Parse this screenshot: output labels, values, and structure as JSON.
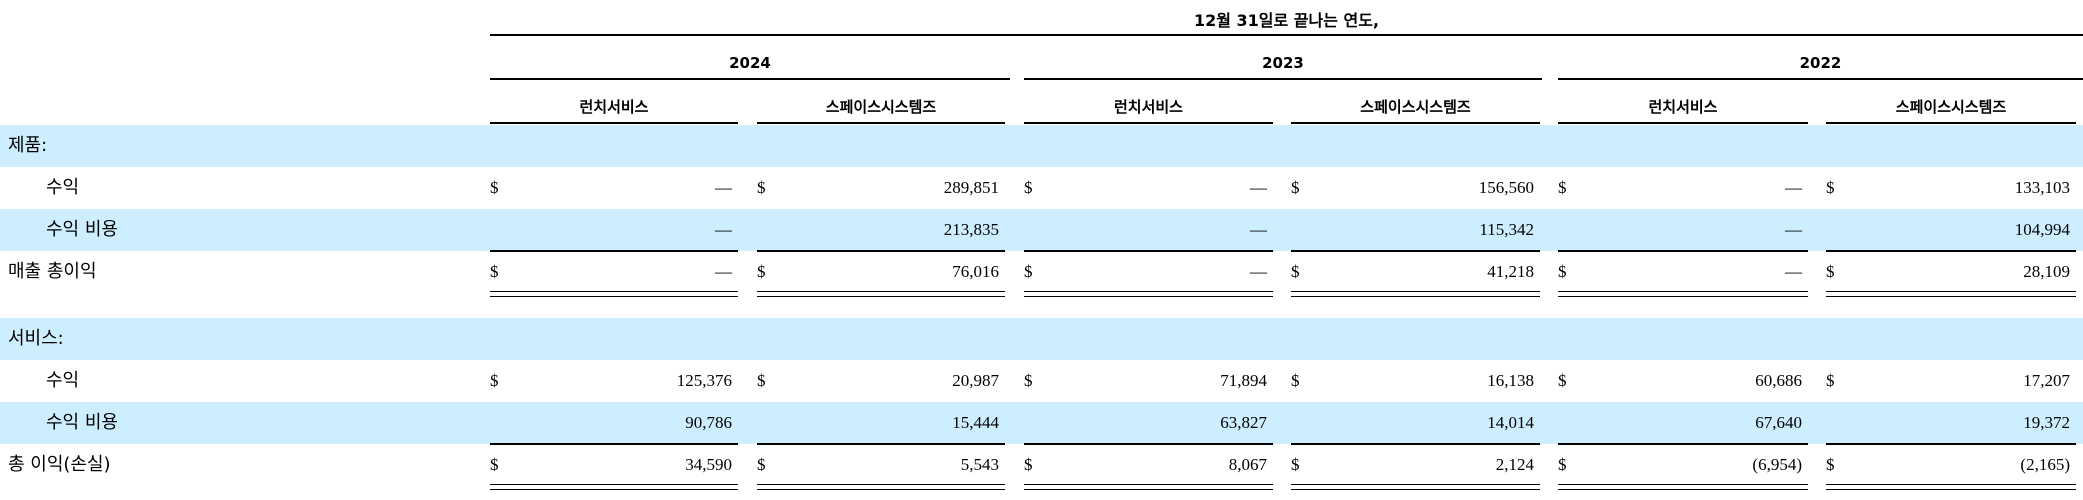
{
  "header": {
    "period_title": "12월 31일로 끝나는 연도,",
    "years": [
      "2024",
      "2023",
      "2022"
    ],
    "segments": [
      "런치서비스",
      "스페이스시스템즈",
      "런치서비스",
      "스페이스시스템즈",
      "런치서비스",
      "스페이스시스템즈"
    ]
  },
  "sections": {
    "products_label": "제품:",
    "services_label": "서비스:"
  },
  "rows": {
    "prod_revenue": {
      "label": "수익",
      "dollars": [
        "$",
        "$",
        "$",
        "$",
        "$",
        "$"
      ],
      "values": [
        "—",
        "289,851",
        "—",
        "156,560",
        "—",
        "133,103"
      ]
    },
    "prod_cost": {
      "label": "수익 비용",
      "values": [
        "—",
        "213,835",
        "—",
        "115,342",
        "—",
        "104,994"
      ]
    },
    "gross_profit": {
      "label": "매출 총이익",
      "dollars": [
        "$",
        "$",
        "$",
        "$",
        "$",
        "$"
      ],
      "values": [
        "—",
        "76,016",
        "—",
        "41,218",
        "—",
        "28,109"
      ]
    },
    "svc_revenue": {
      "label": "수익",
      "dollars": [
        "$",
        "$",
        "$",
        "$",
        "$",
        "$"
      ],
      "values": [
        "125,376",
        "20,987",
        "71,894",
        "16,138",
        "60,686",
        "17,207"
      ]
    },
    "svc_cost": {
      "label": "수익 비용",
      "values": [
        "90,786",
        "15,444",
        "63,827",
        "14,014",
        "67,640",
        "19,372"
      ]
    },
    "total": {
      "label": "총 이익(손실)",
      "dollars": [
        "$",
        "$",
        "$",
        "$",
        "$",
        "$"
      ],
      "values": [
        "34,590",
        "5,543",
        "8,067",
        "2,124",
        "(6,954)",
        "(2,165)"
      ]
    }
  },
  "colors": {
    "shade": "#cceeff"
  }
}
